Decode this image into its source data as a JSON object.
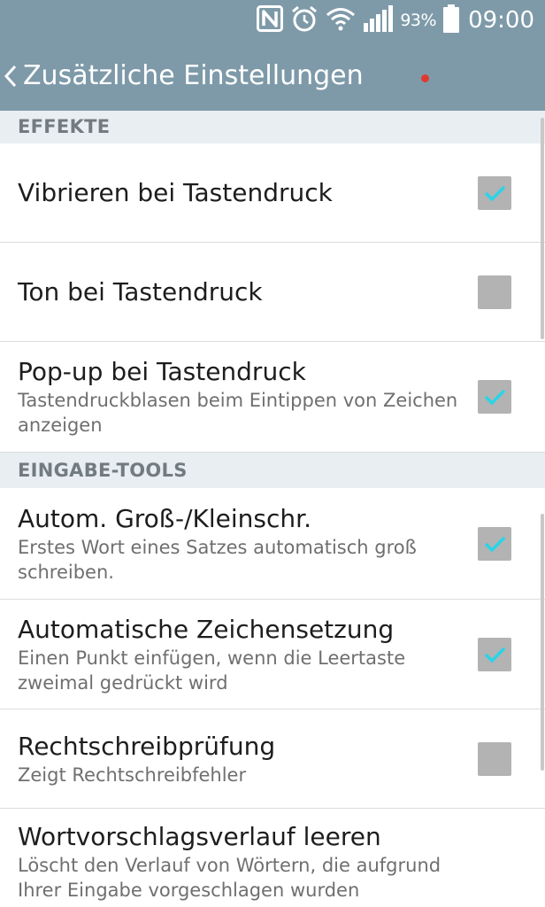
{
  "status_bar": {
    "battery_percent": "93%",
    "time": "09:00",
    "icons": [
      "nfc-icon",
      "alarm-icon",
      "wifi-icon",
      "signal-icon",
      "battery-icon"
    ]
  },
  "action_bar": {
    "title": "Zusätzliche Einstellungen"
  },
  "sections": [
    {
      "header": "EFFEKTE",
      "items": [
        {
          "title": "Vibrieren bei Tastendruck",
          "subtitle": "",
          "checked": true
        },
        {
          "title": "Ton bei Tastendruck",
          "subtitle": "",
          "checked": false
        },
        {
          "title": "Pop-up bei Tastendruck",
          "subtitle": "Tastendruckblasen beim Eintippen von Zeichen anzeigen",
          "checked": true
        }
      ]
    },
    {
      "header": "EINGABE-TOOLS",
      "items": [
        {
          "title": "Autom. Groß-/Kleinschr.",
          "subtitle": "Erstes Wort eines Satzes automatisch groß schreiben.",
          "checked": true
        },
        {
          "title": "Automatische Zeichensetzung",
          "subtitle": "Einen Punkt einfügen, wenn die Leertaste zweimal gedrückt wird",
          "checked": true
        },
        {
          "title": "Rechtschreibprüfung",
          "subtitle": "Zeigt Rechtschreibfehler",
          "checked": false
        },
        {
          "title": "Wortvorschlagsverlauf leeren",
          "subtitle": "Löscht den Verlauf von Wörtern, die aufgrund Ihrer Eingabe vorgeschlagen wurden"
        }
      ]
    }
  ],
  "colors": {
    "header_bg": "#7e9aa9",
    "section_bg": "#e8eef1",
    "checkmark": "#2ad4e6",
    "checkbox": "#b3b3b3"
  }
}
